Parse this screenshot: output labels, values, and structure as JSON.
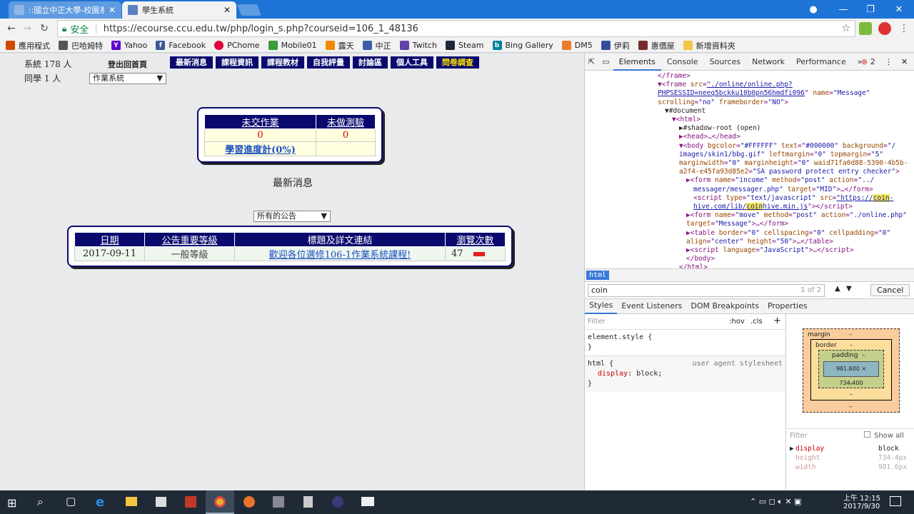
{
  "browser": {
    "tabs": [
      {
        "title": "::國立中正大學-校園系統",
        "active": false
      },
      {
        "title": "學生系統",
        "active": true
      }
    ],
    "security_label": "安全",
    "url": "https://ecourse.ccu.edu.tw/php/login_s.php?courseid=106_1_48136",
    "bookmarks": [
      "應用程式",
      "巴哈姆特",
      "Yahoo",
      "Facebook",
      "PChome",
      "Mobile01",
      "露天",
      "中正",
      "Twitch",
      "Steam",
      "Bing Gallery",
      "DM5",
      "伊莉",
      "惠價屋",
      "新增資料夾"
    ]
  },
  "course_page": {
    "stat_department": "系統 178 人",
    "stat_classmates": "同學 1 人",
    "logout_label": "登出回首頁",
    "nav_items": [
      "最新消息",
      "課程資訊",
      "課程教材",
      "自我評量",
      "討論區",
      "個人工具",
      "問卷調查"
    ],
    "course_select": "作業系統",
    "summary": {
      "headers": [
        "未交作業",
        "未做測驗"
      ],
      "values": [
        "0",
        "0"
      ],
      "progress_link": "學習進度計(0%)"
    },
    "news_heading": "最新消息",
    "news_filter": "所有的公告",
    "news_table": {
      "headers": [
        "日期",
        "公告重要等級",
        "標題及詳文連結",
        "瀏覽次數"
      ],
      "rows": [
        {
          "date": "2017-09-11",
          "level": "一般等級",
          "title": "歡迎各位選修106-1作業系統課程!",
          "views": "47"
        }
      ]
    }
  },
  "devtools": {
    "tabs": [
      "Elements",
      "Console",
      "Sources",
      "Network",
      "Performance"
    ],
    "error_count": "2",
    "breadcrumb": "html",
    "search_value": "coin",
    "search_count": "1 of 2",
    "cancel_label": "Cancel",
    "sub_tabs": [
      "Styles",
      "Event Listeners",
      "DOM Breakpoints",
      "Properties"
    ],
    "filter_placeholder": "Filter",
    "hov_label": ":hov",
    "cls_label": ".cls",
    "rule1_selector": "element.style {",
    "rule2_selector": "html {",
    "rule2_source": "user agent stylesheet",
    "rule2_prop": "display",
    "rule2_val": "block;",
    "box_margin": "margin",
    "box_border": "border",
    "box_padding": "padding",
    "box_dash": "–",
    "box_content": "981.600 × 734.400",
    "computed_filter": "Filter",
    "show_all": "Show all",
    "computed": [
      {
        "prop": "display",
        "value": "block"
      },
      {
        "prop": "height",
        "value": "734.4px"
      },
      {
        "prop": "width",
        "value": "981.6px"
      }
    ]
  },
  "taskbar": {
    "time": "上午 12:15",
    "date": "2017/9/30"
  }
}
